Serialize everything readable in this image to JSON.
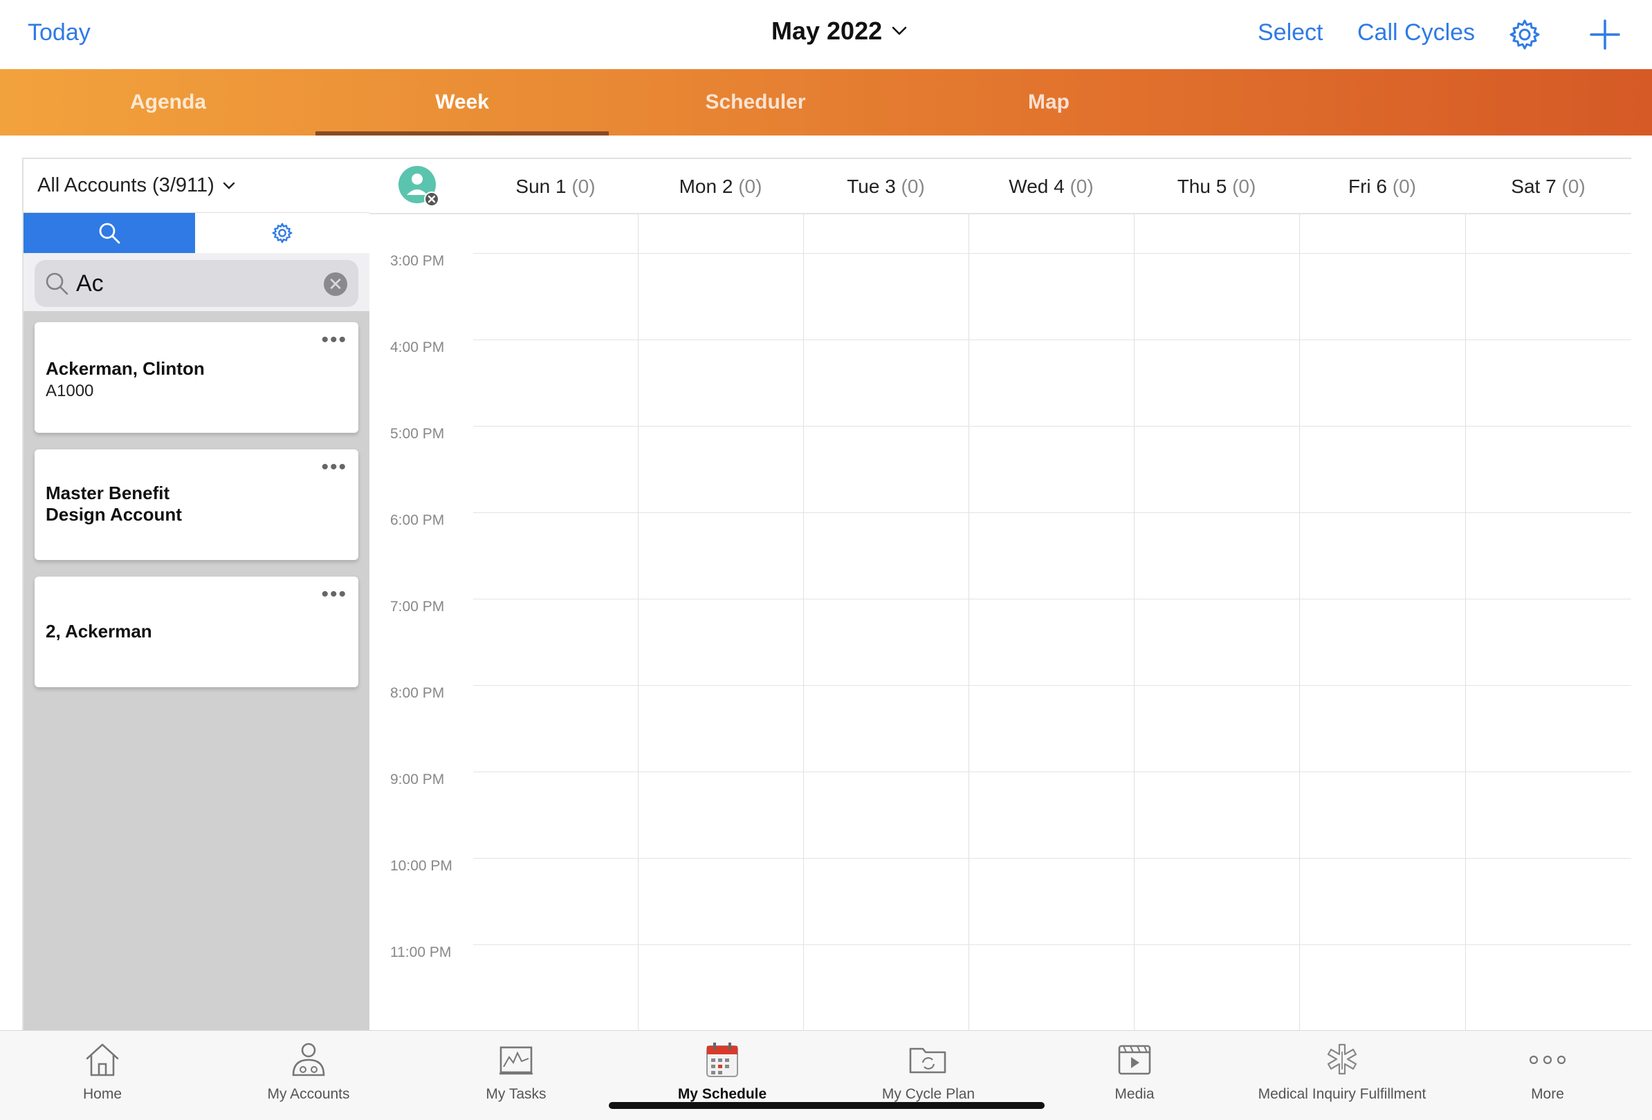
{
  "topbar": {
    "today_label": "Today",
    "month_label": "May 2022",
    "select_label": "Select",
    "call_cycles_label": "Call Cycles"
  },
  "view_tabs": [
    {
      "label": "Agenda",
      "active": false
    },
    {
      "label": "Week",
      "active": true
    },
    {
      "label": "Scheduler",
      "active": false
    },
    {
      "label": "Map",
      "active": false
    }
  ],
  "sidebar": {
    "account_filter": "All Accounts (3/911)",
    "search": {
      "value": "Ac",
      "placeholder": "Search"
    },
    "accounts": [
      {
        "name": "Ackerman, Clinton",
        "id": "A1000"
      },
      {
        "name": "Master Benefit\nDesign Account",
        "id": ""
      },
      {
        "name": "2, Ackerman",
        "id": ""
      }
    ]
  },
  "week": {
    "days": [
      {
        "label": "Sun 1",
        "count": "(0)"
      },
      {
        "label": "Mon 2",
        "count": "(0)"
      },
      {
        "label": "Tue 3",
        "count": "(0)"
      },
      {
        "label": "Wed 4",
        "count": "(0)"
      },
      {
        "label": "Thu 5",
        "count": "(0)"
      },
      {
        "label": "Fri 6",
        "count": "(0)"
      },
      {
        "label": "Sat 7",
        "count": "(0)"
      }
    ],
    "times": [
      "3:00 PM",
      "4:00 PM",
      "5:00 PM",
      "6:00 PM",
      "7:00 PM",
      "8:00 PM",
      "9:00 PM",
      "10:00 PM",
      "11:00 PM"
    ]
  },
  "bottom_nav": [
    {
      "label": "Home",
      "icon": "home-icon",
      "active": false
    },
    {
      "label": "My Accounts",
      "icon": "accounts-icon",
      "active": false
    },
    {
      "label": "My Tasks",
      "icon": "tasks-icon",
      "active": false
    },
    {
      "label": "My Schedule",
      "icon": "calendar-icon",
      "active": true
    },
    {
      "label": "My Cycle Plan",
      "icon": "cycle-plan-icon",
      "active": false
    },
    {
      "label": "Media",
      "icon": "media-icon",
      "active": false
    },
    {
      "label": "Medical Inquiry Fulfillment",
      "icon": "medical-icon",
      "active": false
    },
    {
      "label": "More",
      "icon": "more-icon",
      "active": false
    }
  ],
  "colors": {
    "accent": "#2f7ae5",
    "tab_gradient_start": "#f2a23d",
    "tab_gradient_end": "#d55a26"
  }
}
